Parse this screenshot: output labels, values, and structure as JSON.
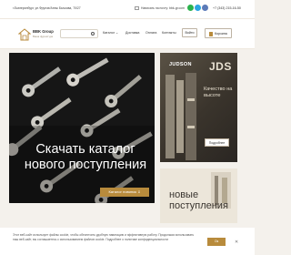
{
  "topbar": {
    "address": "г.Екатеринбург, ул.Фрунзе/Анны Бычкова, 70/27",
    "email": "Написать на почту: bbk-gr.com",
    "phone": "+7 (343) 215-16-50",
    "social_icons": [
      "whatsapp-icon",
      "telegram-icon",
      "vk-icon"
    ]
  },
  "header": {
    "brand": "BBK Group",
    "brand_sub": "Ваша фурнитура",
    "search_placeholder": "",
    "nav": [
      "Каталог ⌄",
      "Доставка",
      "Оплата",
      "Контакты"
    ],
    "login_label": "Войти",
    "cart_label": "Корзина"
  },
  "hero": {
    "title": "Скачать каталог нового поступления",
    "button": "Каталог новинок ⇓"
  },
  "side_card": {
    "brand": "JUDSON",
    "brand_mark": "JDS",
    "text": "Качество на высоте",
    "button": "Подробнее"
  },
  "side_card2": {
    "title": "новые поступления"
  },
  "cookie": {
    "text": "Этот веб-сайт использует файлы cookie, чтобы обеспечить удобную навигацию и эффективную работу. Продолжая использовать наш веб-сайт, вы соглашаетесь с использованием файлов cookie. Подробнее о политике конфиденциальности",
    "ok_button": "Ок"
  },
  "colors": {
    "accent": "#b88b3c",
    "page_bg": "#f4f1ec"
  }
}
